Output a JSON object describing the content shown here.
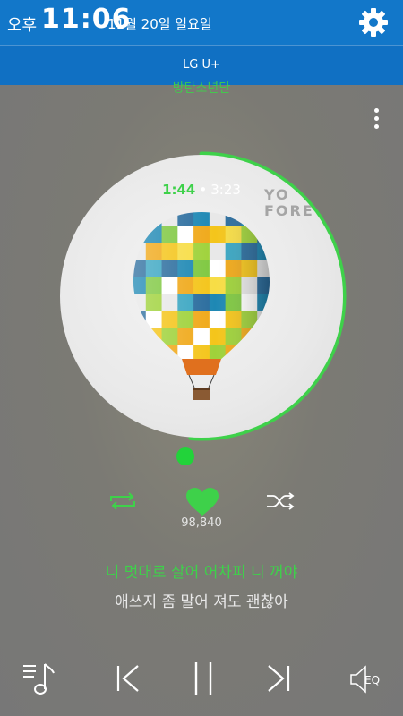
{
  "status_bar": {
    "ampm": "오후",
    "time": "11:06",
    "date": "11월 20일 일요일",
    "settings_icon": "gear-icon"
  },
  "carrier": "LG U+",
  "player": {
    "artist": "방탄소년단",
    "elapsed": "1:44",
    "separator": "•",
    "duration": "3:23",
    "progress_fraction": 0.512,
    "album_text_line1": "YO",
    "album_text_line2": "FORE",
    "likes": "98,840",
    "lyric_current": "니 멋대로 살어 어차피 니 꺼야",
    "lyric_next": "애쓰지 좀 말어 져도 괜찮아",
    "eq_label": "EQ"
  },
  "colors": {
    "accent": "#3ed14a",
    "status_bar_bg": "#1277c9",
    "carrier_bar_bg": "#1070c3"
  }
}
